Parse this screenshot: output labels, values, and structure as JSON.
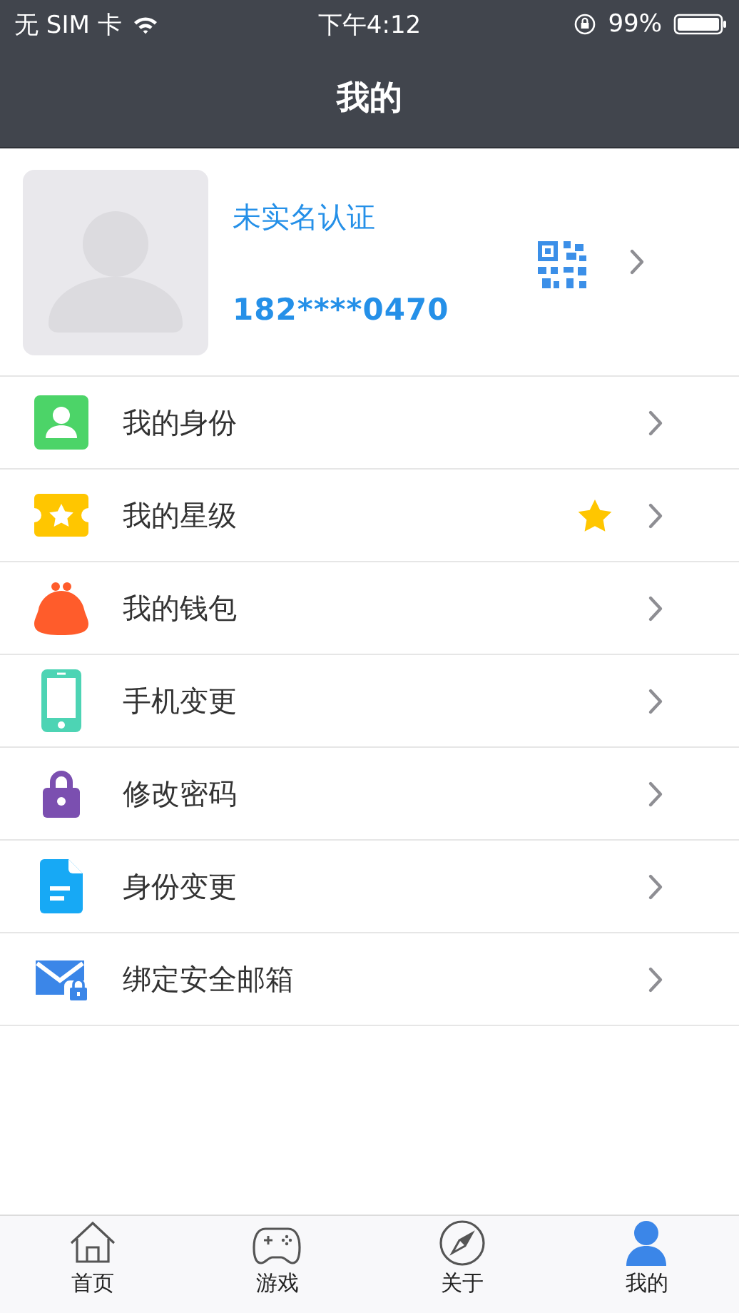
{
  "status_bar": {
    "carrier": "无 SIM 卡",
    "time": "下午4:12",
    "battery": "99%"
  },
  "nav_bar": {
    "title": "我的"
  },
  "profile": {
    "status": "未实名认证",
    "phone": "182****0470"
  },
  "menu": [
    {
      "kind": "identity",
      "label": "我的身份"
    },
    {
      "kind": "rank",
      "label": "我的星级",
      "starred": true
    },
    {
      "kind": "wallet",
      "label": "我的钱包"
    },
    {
      "kind": "phone",
      "label": "手机变更"
    },
    {
      "kind": "password",
      "label": "修改密码"
    },
    {
      "kind": "document",
      "label": "身份变更"
    },
    {
      "kind": "email",
      "label": "绑定安全邮箱"
    }
  ],
  "tab_bar": [
    {
      "kind": "home",
      "label": "首页",
      "selected": false
    },
    {
      "kind": "games",
      "label": "游戏",
      "selected": false
    },
    {
      "kind": "about",
      "label": "关于",
      "selected": false
    },
    {
      "kind": "me",
      "label": "我的",
      "selected": true
    }
  ]
}
